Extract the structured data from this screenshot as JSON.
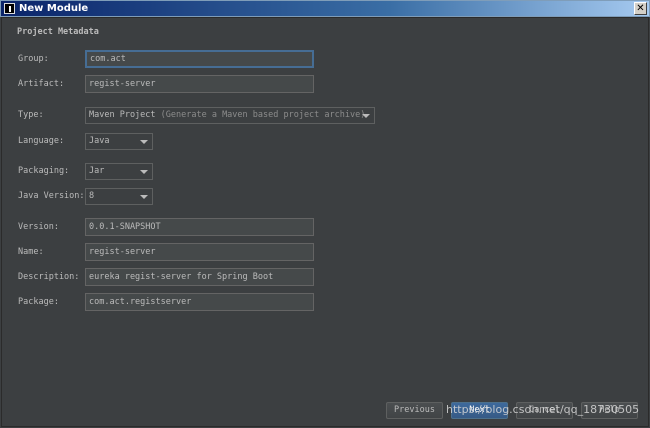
{
  "window": {
    "title": "New Module",
    "close_glyph": "✕"
  },
  "section_title": "Project Metadata",
  "form": {
    "group": {
      "label": "Group:",
      "value": "com.act"
    },
    "artifact": {
      "label": "Artifact:",
      "value": "regist-server"
    },
    "type": {
      "label": "Type:",
      "value": "Maven Project",
      "hint": "(Generate a Maven based project archive)"
    },
    "language": {
      "label": "Language:",
      "value": "Java"
    },
    "packaging": {
      "label": "Packaging:",
      "value": "Jar"
    },
    "java_version": {
      "label": "Java Version:",
      "value": "8"
    },
    "version": {
      "label": "Version:",
      "value": "0.0.1-SNAPSHOT"
    },
    "name": {
      "label": "Name:",
      "value": "regist-server"
    },
    "description": {
      "label": "Description:",
      "value": "eureka regist-server for Spring Boot"
    },
    "package": {
      "label": "Package:",
      "value": "com.act.registserver"
    }
  },
  "buttons": {
    "previous": "Previous",
    "next": "Next",
    "cancel": "Cancel",
    "help": "Help"
  },
  "watermark": "https://blog.csdn.net/qq_18730505",
  "colors": {
    "background": "#3c3f41",
    "field_bg": "#45494a",
    "focus": "#466d94",
    "primary": "#365a86"
  },
  "icons": {
    "app": "intellij-icon",
    "close": "close-icon",
    "dropdown": "chevron-down-icon"
  }
}
